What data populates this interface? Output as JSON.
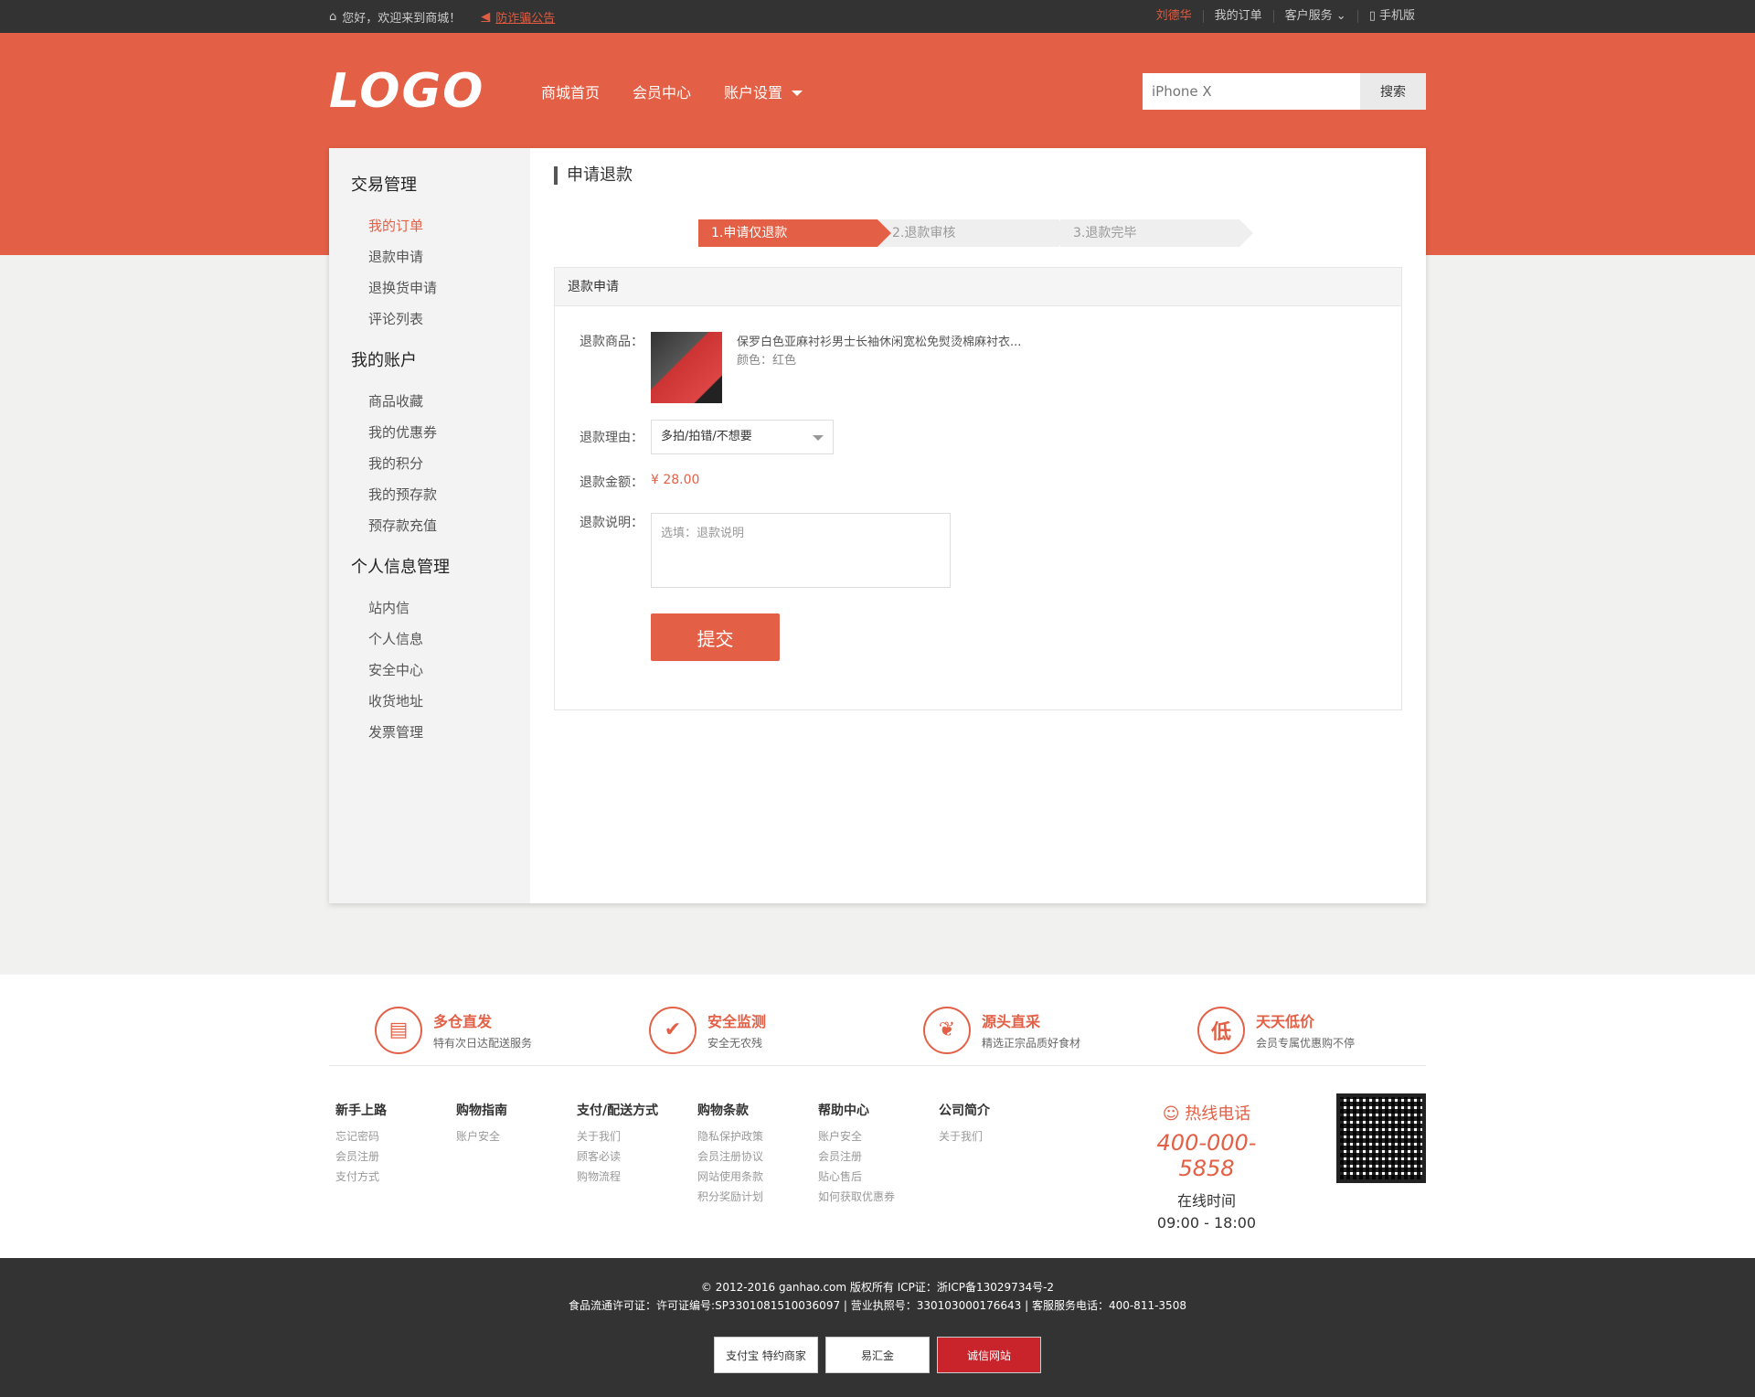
{
  "topbar": {
    "greeting": "您好，欢迎来到商城！",
    "notice": "防诈骗公告",
    "user": "刘德华",
    "my_orders": "我的订单",
    "service": "客户服务",
    "mobile": "手机版"
  },
  "header": {
    "logo": "LOGO",
    "nav": [
      "商城首页",
      "会员中心",
      "账户设置"
    ],
    "search_placeholder": "iPhone X",
    "search_button": "搜索"
  },
  "sidebar": {
    "groups": [
      {
        "title": "交易管理",
        "items": [
          "我的订单",
          "退款申请",
          "退换货申请",
          "评论列表"
        ]
      },
      {
        "title": "我的账户",
        "items": [
          "商品收藏",
          "我的优惠券",
          "我的积分",
          "我的预存款",
          "预存款充值"
        ]
      },
      {
        "title": "个人信息管理",
        "items": [
          "站内信",
          "个人信息",
          "安全中心",
          "收货地址",
          "发票管理"
        ]
      }
    ],
    "active": "我的订单"
  },
  "content": {
    "title": "申请退款",
    "steps": [
      "1.申请仅退款",
      "2.退款审核",
      "3.退款完毕"
    ],
    "panel_title": "退款申请",
    "product_label": "退款商品：",
    "product_name": "保罗白色亚麻衬衫男士长袖休闲宽松免熨烫棉麻衬衣...",
    "product_color": "颜色：红色",
    "reason_label": "退款理由：",
    "reason_value": "多拍/拍错/不想要",
    "amount_label": "退款金额：",
    "amount_value": "¥ 28.00",
    "desc_label": "退款说明：",
    "desc_placeholder": "选填：退款说明",
    "submit": "提交"
  },
  "features": [
    {
      "title": "多仓直发",
      "desc": "特有次日达配送服务",
      "icon": "warehouse-icon"
    },
    {
      "title": "安全监测",
      "desc": "安全无农残",
      "icon": "shield-icon"
    },
    {
      "title": "源头直采",
      "desc": "精选正宗品质好食材",
      "icon": "produce-icon"
    },
    {
      "title": "天天低价",
      "desc": "会员专属优惠购不停",
      "icon": "low-price-icon"
    }
  ],
  "footer_links": [
    {
      "title": "新手上路",
      "items": [
        "忘记密码",
        "会员注册",
        "支付方式"
      ]
    },
    {
      "title": "购物指南",
      "items": [
        "账户安全"
      ]
    },
    {
      "title": "支付/配送方式",
      "items": [
        "关于我们",
        "顾客必读",
        "购物流程"
      ]
    },
    {
      "title": "购物条款",
      "items": [
        "隐私保护政策",
        "会员注册协议",
        "网站使用条款",
        "积分奖励计划"
      ]
    },
    {
      "title": "帮助中心",
      "items": [
        "账户安全",
        "会员注册",
        "贴心售后",
        "如何获取优惠券"
      ]
    },
    {
      "title": "公司简介",
      "items": [
        "关于我们"
      ]
    }
  ],
  "hotline": {
    "label": "热线电话",
    "phone": "400-000-5858",
    "time_label": "在线时间",
    "time": "09:00 - 18:00"
  },
  "copyright": {
    "line1": "© 2012-2016 ganhao.com 版权所有 ICP证：浙ICP备13029734号-2",
    "line2": "食品流通许可证：许可证编号:SP3301081510036097 | 营业执照号：330103000176643 | 客服服务电话：400-811-3508"
  },
  "badges": [
    "支付宝 特约商家",
    "易汇金",
    "诚信网站"
  ],
  "colors": {
    "accent": "#e35f45",
    "dark": "#333333"
  }
}
